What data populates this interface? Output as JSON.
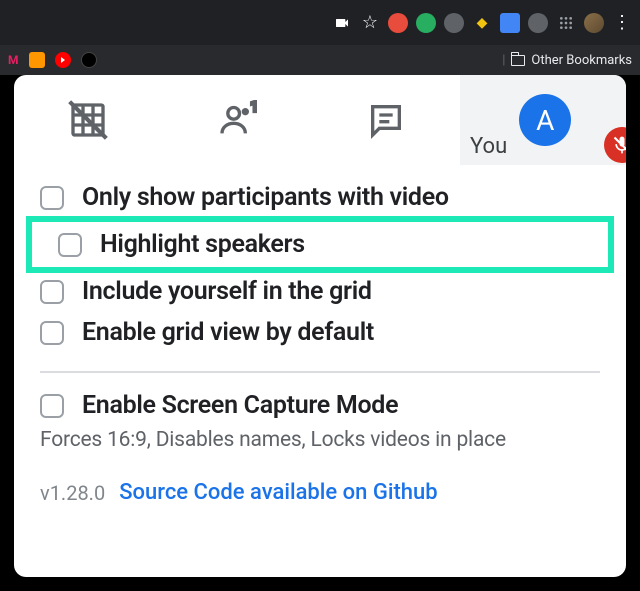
{
  "bookmarks": {
    "other_label": "Other Bookmarks"
  },
  "meet": {
    "you_label": "You",
    "avatar_initial": "A"
  },
  "options": {
    "only_video": "Only show participants with video",
    "highlight_speakers": "Highlight speakers",
    "include_self": "Include yourself in the grid",
    "default_grid": "Enable grid view by default",
    "capture_mode": "Enable Screen Capture Mode",
    "capture_desc": "Forces 16:9, Disables names, Locks videos in place"
  },
  "footer": {
    "version": "v1.28.0",
    "source_link": "Source Code available on Github"
  }
}
